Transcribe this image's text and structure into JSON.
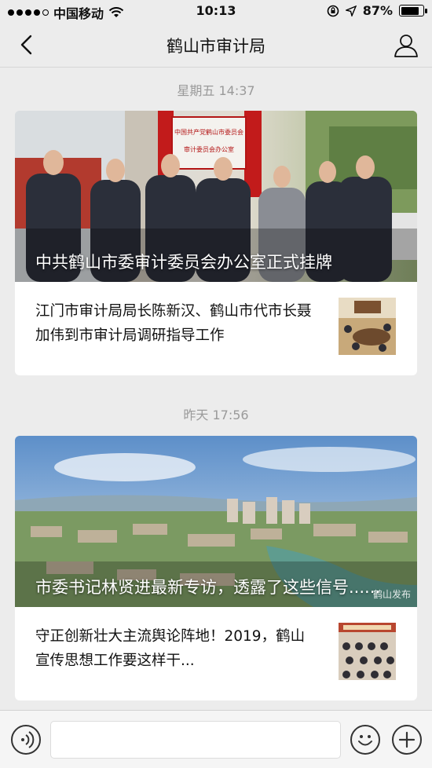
{
  "status_bar": {
    "carrier": "中国移动",
    "time": "10:13",
    "battery": "87%",
    "battery_level": 0.87
  },
  "nav": {
    "title": "鹤山市审计局",
    "back_icon": "chevron-left-icon",
    "profile_icon": "person-icon"
  },
  "messages": [
    {
      "time": "星期五 14:37",
      "hero_title": "中共鹤山市委审计委员会办公室正式挂牌",
      "sub_title": "江门市审计局局长陈新汉、鹤山市代市长聂加伟到市审计局调研指导工作",
      "banner_text_1": "中国共产党鹤山市委员会",
      "banner_text_2": "审计委员会办公室"
    },
    {
      "time": "昨天 17:56",
      "hero_title": "市委书记林贤进最新专访，透露了这些信号......",
      "sub_title": "守正创新壮大主流舆论阵地！2019，鹤山宣传思想工作要这样干...",
      "watermark": "鹤山发布"
    }
  ],
  "input_bar": {
    "placeholder": "",
    "voice_icon": "voice-icon",
    "emoji_icon": "emoji-icon",
    "add_icon": "plus-icon"
  }
}
